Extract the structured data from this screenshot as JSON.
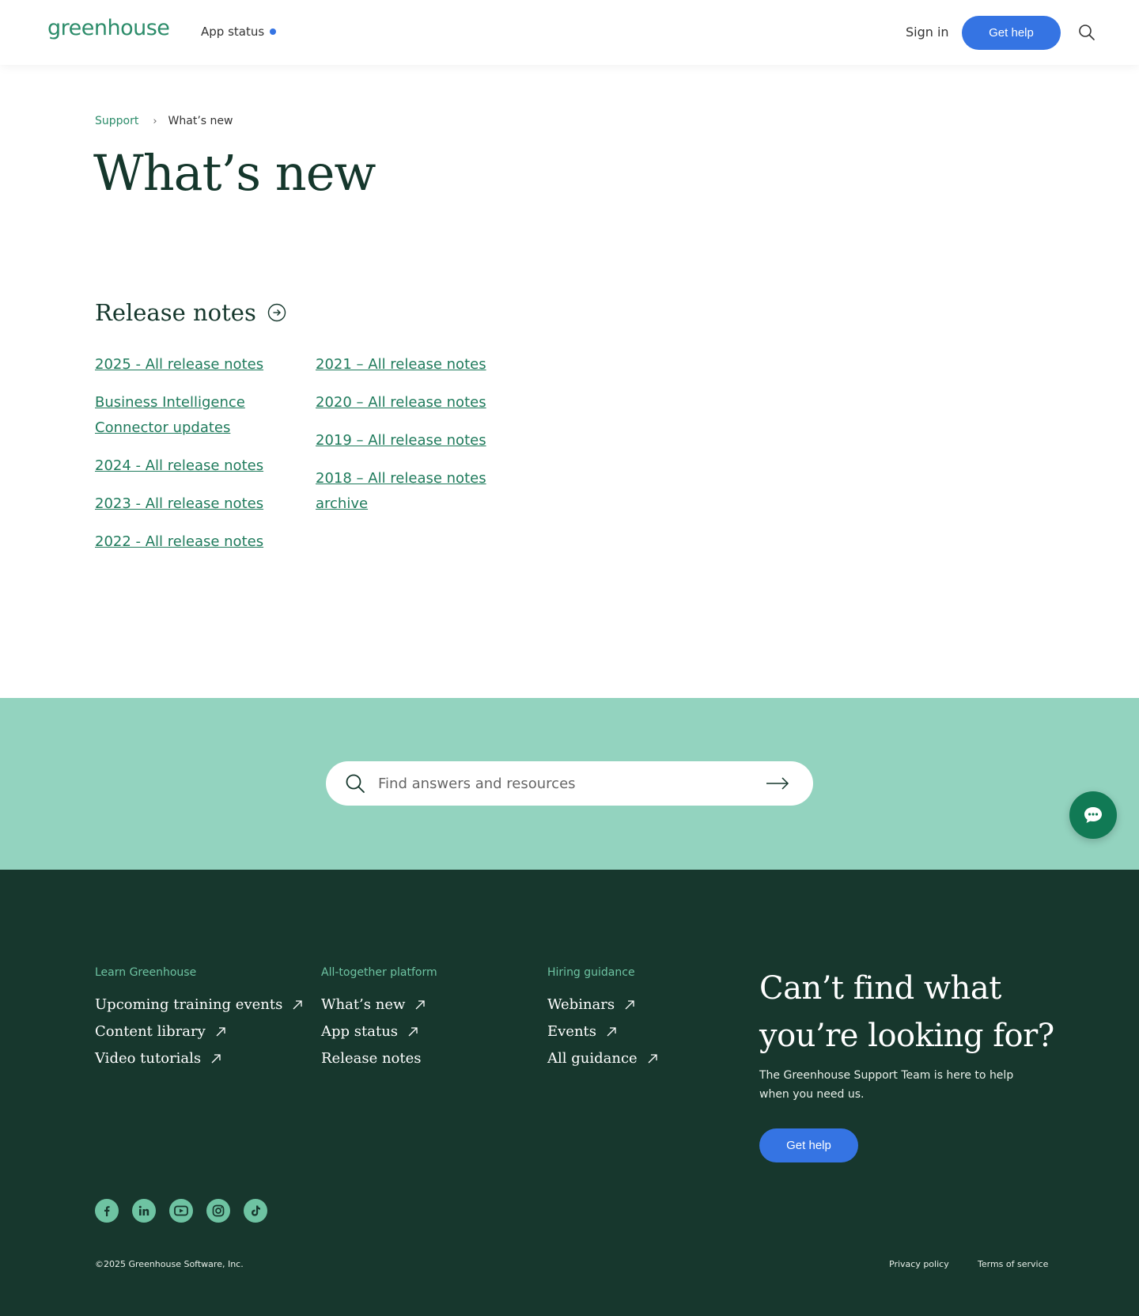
{
  "header": {
    "logo": "greenhouse",
    "app_status": "App status",
    "sign_in": "Sign in",
    "get_help": "Get help",
    "status_dot_color": "#3574e3"
  },
  "breadcrumb": {
    "parent": "Support",
    "current": "What’s new"
  },
  "page": {
    "title": "What’s new",
    "section_title": "Release notes",
    "release_links_col1": [
      "2025 - All release notes",
      "Business Intelligence Connector updates",
      "2024 - All release notes",
      "2023 - All release notes",
      "2022 - All release notes"
    ],
    "release_links_col2": [
      "2021 – All release notes",
      "2020 – All release notes",
      "2019 – All release notes",
      "2018 – All release notes archive"
    ]
  },
  "search": {
    "placeholder": "Find answers and resources"
  },
  "footer": {
    "learn": {
      "title": "Learn Greenhouse",
      "items": [
        "Upcoming training events",
        "Content library",
        "Video tutorials"
      ]
    },
    "platform": {
      "title": "All-together platform",
      "items": [
        "What’s new",
        "App status",
        "Release notes"
      ]
    },
    "hiring": {
      "title": "Hiring guidance",
      "items": [
        "Webinars",
        "Events",
        "All guidance"
      ]
    },
    "cta_title": "Can’t find what you’re looking for?",
    "cta_text": "The Greenhouse Support Team is here to help when you need us.",
    "cta_button": "Get help",
    "social_icons": [
      "facebook-icon",
      "linkedin-icon",
      "youtube-icon",
      "instagram-icon",
      "tiktok-icon"
    ],
    "copyright": "©2025 Greenhouse Software, Inc.",
    "privacy": "Privacy policy",
    "terms": "Terms of service"
  },
  "colors": {
    "brand_green": "#2c8c6a",
    "accent_blue": "#3574e3",
    "band_mint": "#93d3bf",
    "footer_dark": "#17372d"
  }
}
